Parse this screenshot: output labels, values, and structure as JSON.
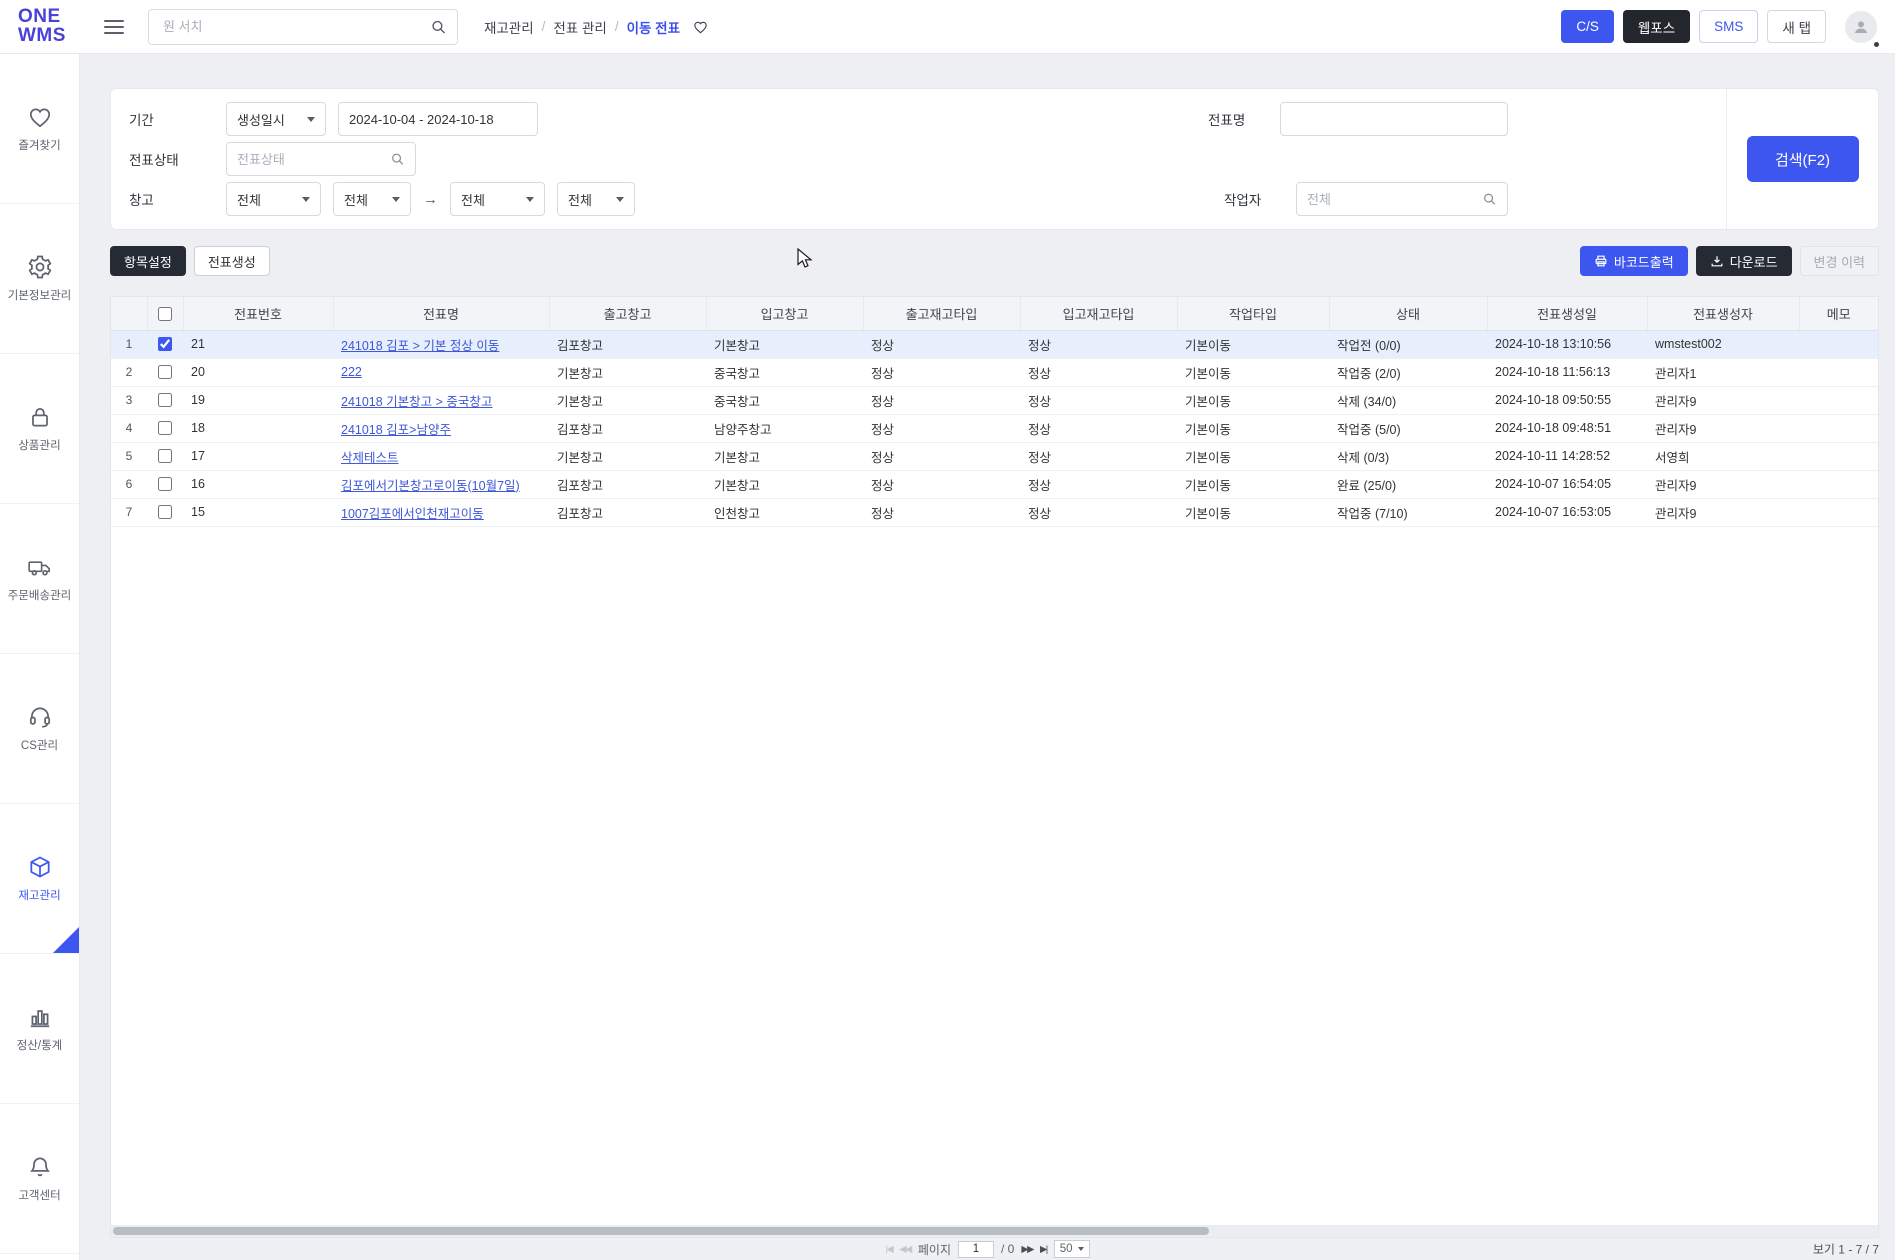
{
  "header": {
    "logo": {
      "line1": "ONE",
      "line2": "WMS"
    },
    "search": {
      "placeholder": "원 서치"
    },
    "breadcrumb": {
      "items": [
        "재고관리",
        "전표 관리",
        "이동 전표"
      ],
      "separator": "/"
    },
    "actions": {
      "cs": "C/S",
      "webpos": "웹포스",
      "sms": "SMS",
      "new_tab": "새 탭"
    }
  },
  "sidebar": {
    "items": [
      {
        "label": "즐겨찾기",
        "icon": "heart-icon"
      },
      {
        "label": "기본정보관리",
        "icon": "gear-icon"
      },
      {
        "label": "상품관리",
        "icon": "lock-icon"
      },
      {
        "label": "주문배송관리",
        "icon": "truck-icon"
      },
      {
        "label": "CS관리",
        "icon": "headset-icon"
      },
      {
        "label": "재고관리",
        "icon": "cube-icon",
        "active": true
      },
      {
        "label": "정산/통계",
        "icon": "bar-chart-icon"
      },
      {
        "label": "고객센터",
        "icon": "bell-icon"
      }
    ]
  },
  "filters": {
    "period": {
      "label": "기간",
      "type_select": "생성일시",
      "date_range": "2024-10-04 - 2024-10-18"
    },
    "slip_name": {
      "label": "전표명",
      "value": ""
    },
    "slip_status": {
      "label": "전표상태",
      "placeholder": "전표상태"
    },
    "warehouse": {
      "label": "창고",
      "selects": [
        "전체",
        "전체",
        "전체",
        "전체"
      ],
      "arrow": "→"
    },
    "worker": {
      "label": "작업자",
      "placeholder": "전체"
    },
    "search_button": "검색(F2)"
  },
  "toolbar": {
    "item_settings": "항목설정",
    "create_slip": "전표생성",
    "barcode_print": "바코드출력",
    "download": "다운로드",
    "change_history": "변경 이력"
  },
  "table": {
    "columns": [
      "전표번호",
      "전표명",
      "출고창고",
      "입고창고",
      "출고재고타입",
      "입고재고타입",
      "작업타입",
      "상태",
      "전표생성일",
      "전표생성자",
      "메모"
    ],
    "rows": [
      {
        "index": 1,
        "checked": true,
        "selected": true,
        "slip_no": "21",
        "slip_name": "241018 김포 > 기본 정상 이동",
        "out_warehouse": "김포창고",
        "in_warehouse": "기본창고",
        "out_stock_type": "정상",
        "in_stock_type": "정상",
        "work_type": "기본이동",
        "status": "작업전 (0/0)",
        "created_at": "2024-10-18 13:10:56",
        "created_by": "wmstest002",
        "memo": ""
      },
      {
        "index": 2,
        "slip_no": "20",
        "slip_name": "222",
        "out_warehouse": "기본창고",
        "in_warehouse": "중국창고",
        "out_stock_type": "정상",
        "in_stock_type": "정상",
        "work_type": "기본이동",
        "status": "작업중 (2/0)",
        "created_at": "2024-10-18 11:56:13",
        "created_by": "관리자1",
        "memo": ""
      },
      {
        "index": 3,
        "slip_no": "19",
        "slip_name": "241018 기본창고 > 중국창고",
        "out_warehouse": "기본창고",
        "in_warehouse": "중국창고",
        "out_stock_type": "정상",
        "in_stock_type": "정상",
        "work_type": "기본이동",
        "status": "삭제 (34/0)",
        "created_at": "2024-10-18 09:50:55",
        "created_by": "관리자9",
        "memo": ""
      },
      {
        "index": 4,
        "slip_no": "18",
        "slip_name": "241018 김포>남양주",
        "out_warehouse": "김포창고",
        "in_warehouse": "남양주창고",
        "out_stock_type": "정상",
        "in_stock_type": "정상",
        "work_type": "기본이동",
        "status": "작업중 (5/0)",
        "created_at": "2024-10-18 09:48:51",
        "created_by": "관리자9",
        "memo": ""
      },
      {
        "index": 5,
        "slip_no": "17",
        "slip_name": "삭제테스트",
        "out_warehouse": "기본창고",
        "in_warehouse": "기본창고",
        "out_stock_type": "정상",
        "in_stock_type": "정상",
        "work_type": "기본이동",
        "status": "삭제 (0/3)",
        "created_at": "2024-10-11 14:28:52",
        "created_by": "서영희",
        "memo": ""
      },
      {
        "index": 6,
        "slip_no": "16",
        "slip_name": "김포에서기본창고로이동(10월7일)",
        "out_warehouse": "김포창고",
        "in_warehouse": "기본창고",
        "out_stock_type": "정상",
        "in_stock_type": "정상",
        "work_type": "기본이동",
        "status": "완료 (25/0)",
        "created_at": "2024-10-07 16:54:05",
        "created_by": "관리자9",
        "memo": ""
      },
      {
        "index": 7,
        "slip_no": "15",
        "slip_name": "1007김포에서인천재고이동",
        "out_warehouse": "김포창고",
        "in_warehouse": "인천창고",
        "out_stock_type": "정상",
        "in_stock_type": "정상",
        "work_type": "기본이동",
        "status": "작업중 (7/10)",
        "created_at": "2024-10-07 16:53:05",
        "created_by": "관리자9",
        "memo": ""
      }
    ]
  },
  "pagination": {
    "icons": {
      "first": "|◀",
      "prev": "◀◀",
      "next": "▶▶",
      "last": "▶|"
    },
    "page_label": "페이지",
    "page_value": "1",
    "total_label": "/ 0",
    "page_size": "50",
    "summary": "보기 1 - 7 / 7"
  },
  "colors": {
    "primary": "#3d56f0",
    "logo": "#4a42d8",
    "dark_button": "#262b33",
    "selected_row": "#e7effc",
    "link": "#3f57d8"
  }
}
